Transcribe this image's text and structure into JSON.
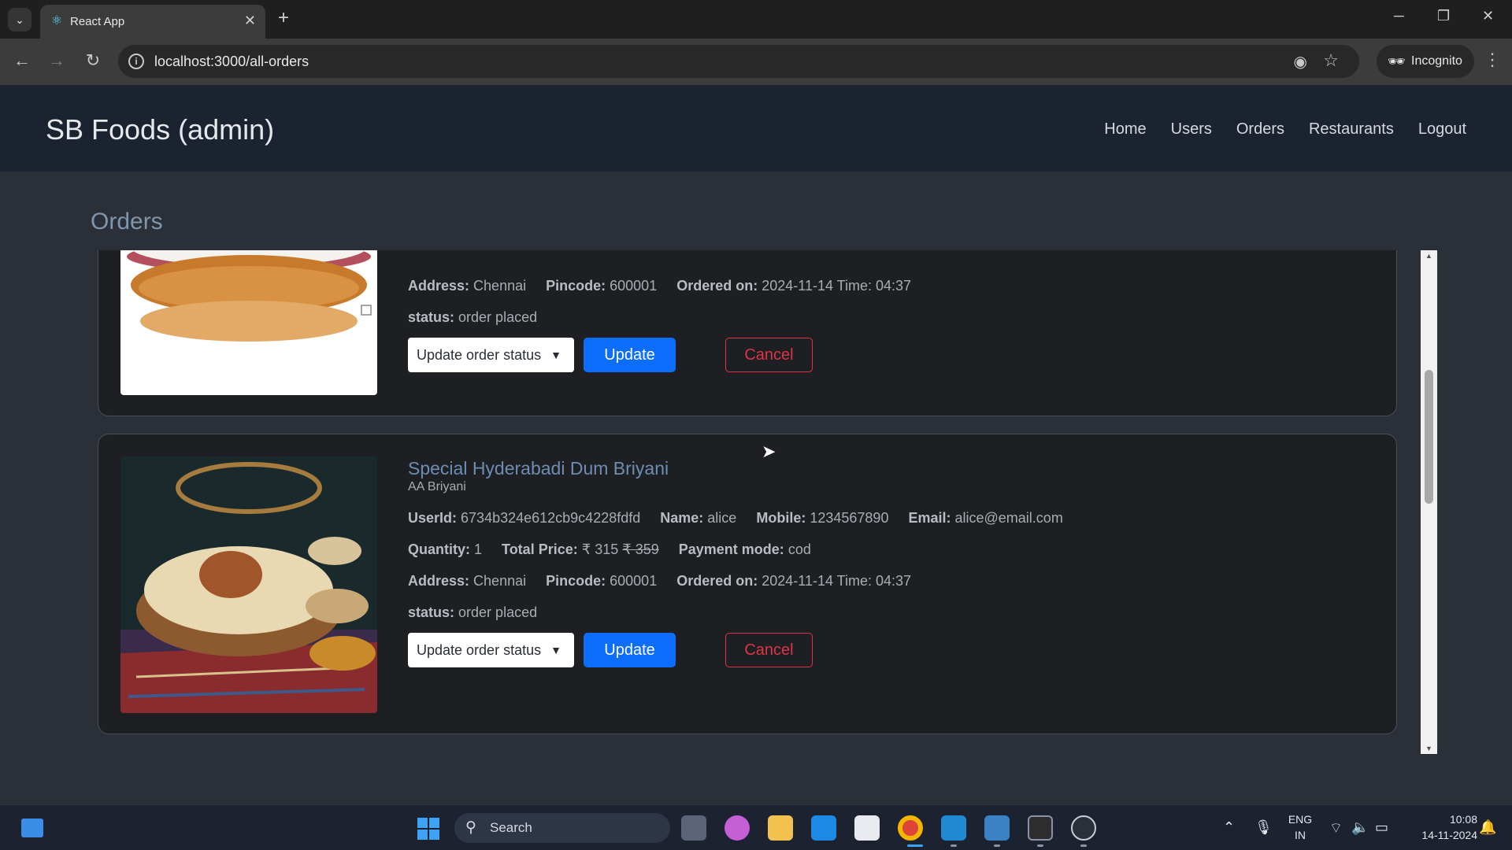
{
  "browser": {
    "tab_title": "React App",
    "url": "localhost:3000/all-orders",
    "incognito_label": "Incognito"
  },
  "navbar": {
    "brand": "SB Foods (admin)",
    "links": [
      "Home",
      "Users",
      "Orders",
      "Restaurants",
      "Logout"
    ]
  },
  "page": {
    "title": "Orders"
  },
  "orders": [
    {
      "image": "burger",
      "address_label": "Address:",
      "address": "Chennai",
      "pincode_label": "Pincode:",
      "pincode": "600001",
      "ordered_label": "Ordered on:",
      "ordered_on": "2024-11-14 Time: 04:37",
      "status_label": "status:",
      "status": "order placed",
      "select_placeholder": "Update order status",
      "update_label": "Update",
      "cancel_label": "Cancel"
    },
    {
      "image": "biryani",
      "title": "Special Hyderabadi Dum Briyani",
      "restaurant": "AA Briyani",
      "userid_label": "UserId:",
      "userid": "6734b324e612cb9c4228fdfd",
      "name_label": "Name:",
      "name": "alice",
      "mobile_label": "Mobile:",
      "mobile": "1234567890",
      "email_label": "Email:",
      "email": "alice@email.com",
      "qty_label": "Quantity:",
      "quantity": "1",
      "price_label": "Total Price:",
      "price": "₹ 315",
      "original_price": "₹ 359",
      "payment_label": "Payment mode:",
      "payment": "cod",
      "address_label": "Address:",
      "address": "Chennai",
      "pincode_label": "Pincode:",
      "pincode": "600001",
      "ordered_label": "Ordered on:",
      "ordered_on": "2024-11-14 Time: 04:37",
      "status_label": "status:",
      "status": "order placed",
      "select_placeholder": "Update order status",
      "update_label": "Update",
      "cancel_label": "Cancel"
    }
  ],
  "taskbar": {
    "search_label": "Search",
    "lang_1": "ENG",
    "lang_2": "IN",
    "time": "10:08",
    "date": "14-11-2024"
  },
  "colors": {
    "primary": "#0d6efd",
    "danger": "#dc3545",
    "navbar_bg": "#1b2230",
    "page_bg": "#2b3038",
    "card_bg": "#1d1f23",
    "title_blue": "#6d8db3"
  }
}
